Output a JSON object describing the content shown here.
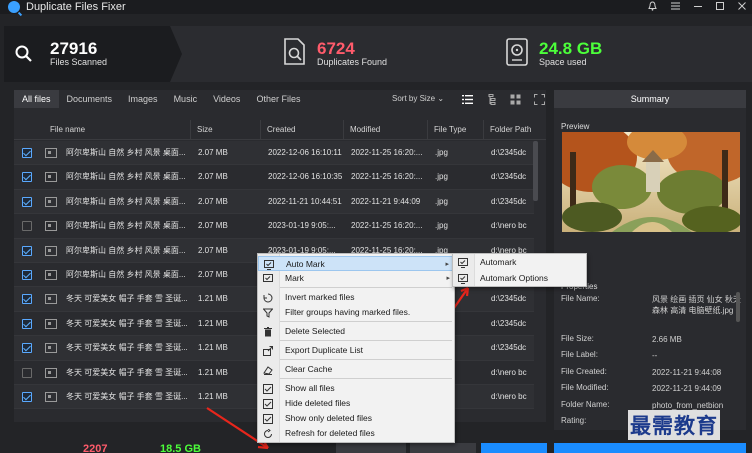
{
  "window": {
    "title": "Duplicate Files Fixer",
    "controls": [
      "bell-icon",
      "menu-icon",
      "minimize-icon",
      "maximize-icon",
      "close-icon"
    ]
  },
  "stats": {
    "scanned_value": "27916",
    "scanned_label": "Files Scanned",
    "dupes_value": "6724",
    "dupes_label": "Duplicates Found",
    "dupes_color": "#ff5b6b",
    "space_value": "24.8 GB",
    "space_label": "Space used",
    "space_color": "#4cff3a"
  },
  "tabs": [
    "All files",
    "Documents",
    "Images",
    "Music",
    "Videos",
    "Other Files"
  ],
  "sort_by": "Sort by Size",
  "columns": [
    "File name",
    "Size",
    "Created",
    "Modified",
    "File Type",
    "Folder Path"
  ],
  "rows": [
    {
      "checked": true,
      "name": "阿尔卑斯山 自然 乡村 风景 桌面...",
      "size": "2.07 MB",
      "created": "2022-12-06 16:10:11",
      "modified": "2022-11-25 16:20:...",
      "type": ".jpg",
      "path": "d:\\2345dc"
    },
    {
      "checked": true,
      "name": "阿尔卑斯山 自然 乡村 风景 桌面...",
      "size": "2.07 MB",
      "created": "2022-12-06 16:10:35",
      "modified": "2022-11-25 16:20:...",
      "type": ".jpg",
      "path": "d:\\2345dc"
    },
    {
      "checked": true,
      "name": "阿尔卑斯山 自然 乡村 风景 桌面...",
      "size": "2.07 MB",
      "created": "2022-11-21 10:44:51",
      "modified": "2022-11-21 9:44:09",
      "type": ".jpg",
      "path": "d:\\2345dc"
    },
    {
      "checked": false,
      "name": "阿尔卑斯山 自然 乡村 风景 桌面...",
      "size": "2.07 MB",
      "created": "2023-01-19 9:05:...",
      "modified": "2022-11-25 16:20:...",
      "type": ".jpg",
      "path": "d:\\nero bc"
    },
    {
      "checked": true,
      "name": "阿尔卑斯山 自然 乡村 风景 桌面...",
      "size": "2.07 MB",
      "created": "2023-01-19 9:05:...",
      "modified": "2022-11-25 16:20:...",
      "type": ".jpg",
      "path": "d:\\nero bc"
    },
    {
      "checked": true,
      "name": "阿尔卑斯山 自然 乡村 风景 桌面...",
      "size": "2.07 MB",
      "created": "",
      "modified": "",
      "type": "",
      "path": "d:\\2345dc"
    },
    {
      "checked": true,
      "name": "冬天 可爱美女 帽子 手套 雪 圣诞...",
      "size": "1.21 MB",
      "created": "",
      "modified": "",
      "type": "",
      "path": "d:\\2345dc"
    },
    {
      "checked": true,
      "name": "冬天 可爱美女 帽子 手套 雪 圣诞...",
      "size": "1.21 MB",
      "created": "",
      "modified": "",
      "type": "",
      "path": "d:\\2345dc"
    },
    {
      "checked": true,
      "name": "冬天 可爱美女 帽子 手套 雪 圣诞...",
      "size": "1.21 MB",
      "created": "",
      "modified": "",
      "type": "",
      "path": "d:\\2345dc"
    },
    {
      "checked": false,
      "name": "冬天 可爱美女 帽子 手套 雪 圣诞...",
      "size": "1.21 MB",
      "created": "",
      "modified": "",
      "type": "",
      "path": "d:\\nero bc"
    },
    {
      "checked": true,
      "name": "冬天 可爱美女 帽子 手套 雪 圣诞...",
      "size": "1.21 MB",
      "created": "",
      "modified": "",
      "type": "",
      "path": "d:\\nero bc"
    }
  ],
  "summary": {
    "title": "Summary",
    "preview_label": "Preview",
    "properties_label": "Properties",
    "props": [
      {
        "k": "File Name:",
        "v": "风景 绘画 插页 仙女 秋天 森林 高清 电脑壁纸.jpg"
      },
      {
        "k": "File Size:",
        "v": "2.66 MB"
      },
      {
        "k": "File Label:",
        "v": "--"
      },
      {
        "k": "File Created:",
        "v": "2022-11-21 9:44:08"
      },
      {
        "k": "File Modified:",
        "v": "2022-11-21 9:44:09"
      },
      {
        "k": "Folder Name:",
        "v": "photo_from_netbion"
      },
      {
        "k": "Rating:",
        "v": ""
      }
    ]
  },
  "bottom": {
    "num1": "2207",
    "num2": "18.5 GB"
  },
  "context_menu": {
    "items": [
      {
        "label": "Auto Mark",
        "icon": "auto-mark-icon",
        "submenu": true,
        "highlight": true
      },
      {
        "label": "Mark",
        "icon": "mark-icon",
        "submenu": true
      },
      {
        "label": "Invert marked files",
        "icon": "invert-icon"
      },
      {
        "label": "Filter groups having marked files.",
        "icon": "filter-icon"
      },
      {
        "label": "Delete Selected",
        "icon": "trash-icon"
      },
      {
        "label": "Export Duplicate List",
        "icon": "export-icon"
      },
      {
        "label": "Clear Cache",
        "icon": "clear-cache-icon"
      },
      {
        "label": "Show all files",
        "icon": "show-all-icon"
      },
      {
        "label": "Hide deleted files",
        "icon": "hide-deleted-icon"
      },
      {
        "label": "Show only deleted files",
        "icon": "show-deleted-icon"
      },
      {
        "label": "Refresh for deleted files",
        "icon": "refresh-icon"
      }
    ],
    "submenu": [
      "Automark",
      "Automark Options"
    ]
  },
  "watermark": "最需教育"
}
